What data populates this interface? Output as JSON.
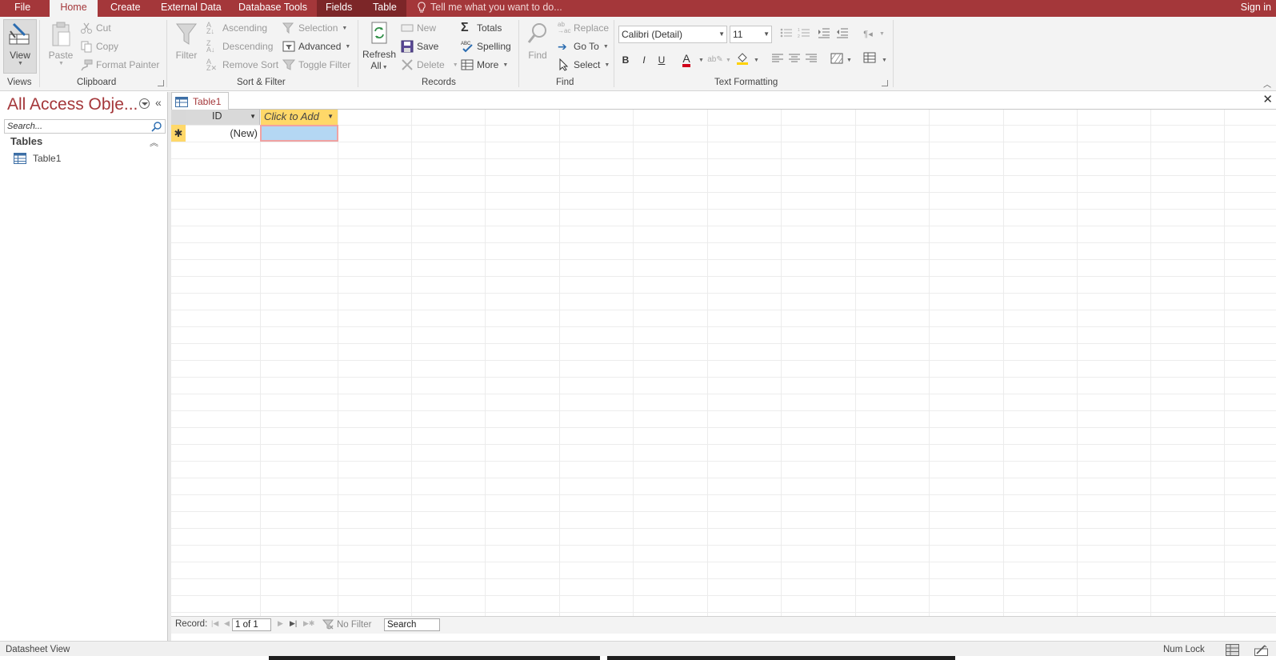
{
  "tabs": {
    "file": "File",
    "home": "Home",
    "create": "Create",
    "external_data": "External Data",
    "database_tools": "Database Tools",
    "fields": "Fields",
    "table": "Table"
  },
  "tell_me": "Tell me what you want to do...",
  "sign_in": "Sign in",
  "ribbon": {
    "views": {
      "view": "View",
      "group": "Views"
    },
    "clipboard": {
      "paste": "Paste",
      "cut": "Cut",
      "copy": "Copy",
      "format_painter": "Format Painter",
      "group": "Clipboard"
    },
    "sort_filter": {
      "filter": "Filter",
      "ascending": "Ascending",
      "descending": "Descending",
      "remove_sort": "Remove Sort",
      "selection": "Selection",
      "advanced": "Advanced",
      "toggle_filter": "Toggle Filter",
      "group": "Sort & Filter"
    },
    "records": {
      "refresh": "Refresh",
      "refresh_all": "All",
      "new": "New",
      "save": "Save",
      "delete": "Delete",
      "totals": "Totals",
      "spelling": "Spelling",
      "more": "More",
      "group": "Records"
    },
    "find": {
      "find": "Find",
      "replace": "Replace",
      "goto": "Go To",
      "select": "Select",
      "group": "Find"
    },
    "text_formatting": {
      "font": "Calibri (Detail)",
      "size": "11",
      "bold": "B",
      "italic": "I",
      "underline": "U",
      "font_color_letter": "A",
      "group": "Text Formatting"
    }
  },
  "nav": {
    "title": "All Access Obje...",
    "search_placeholder": "Search...",
    "group": "Tables",
    "items": [
      {
        "label": "Table1"
      }
    ]
  },
  "document": {
    "tab": "Table1",
    "columns": [
      {
        "label": "ID"
      },
      {
        "label": "Click to Add"
      }
    ],
    "new_row": {
      "selector": "✱",
      "id": "(New)"
    }
  },
  "record_nav": {
    "label": "Record:",
    "position": "1 of 1",
    "filter_status": "No Filter",
    "search": "Search"
  },
  "status": {
    "view": "Datasheet View",
    "num_lock": "Num Lock"
  },
  "colors": {
    "brand": "#a4373a",
    "header_yellow": "#ffd869",
    "selected_cell": "#b4d7f3"
  }
}
